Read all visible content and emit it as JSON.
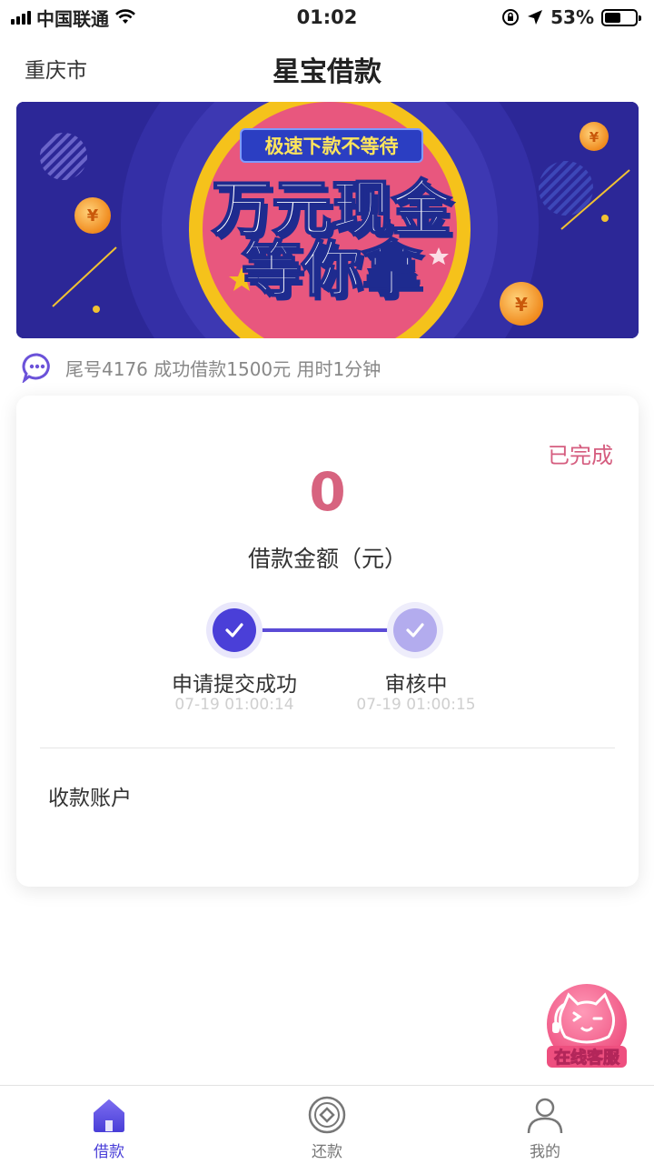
{
  "status_bar": {
    "carrier": "中国联通",
    "time": "01:02",
    "battery": "53%",
    "battery_level": 0.53
  },
  "header": {
    "city": "重庆市",
    "title": "星宝借款"
  },
  "banner": {
    "tag": "极速下款不等待",
    "line1": "万元现金",
    "line2": "等你拿",
    "coin_symbol": "¥"
  },
  "notice": {
    "text": "尾号4176 成功借款1500元 用时1分钟"
  },
  "loan_card": {
    "status": "已完成",
    "amount": "0",
    "amount_label": "借款金额（元）",
    "steps": [
      {
        "title": "申请提交成功",
        "time": "07-19 01:00:14"
      },
      {
        "title": "审核中",
        "time": "07-19 01:00:15"
      }
    ],
    "account_label": "收款账户"
  },
  "service_button": {
    "label": "在线客服"
  },
  "tabs": [
    {
      "label": "借款"
    },
    {
      "label": "还款"
    },
    {
      "label": "我的"
    }
  ],
  "colors": {
    "accent": "#4a3fd8",
    "amount": "#d7637f",
    "status": "#d55d7f",
    "banner_bg": "#2c2797"
  }
}
